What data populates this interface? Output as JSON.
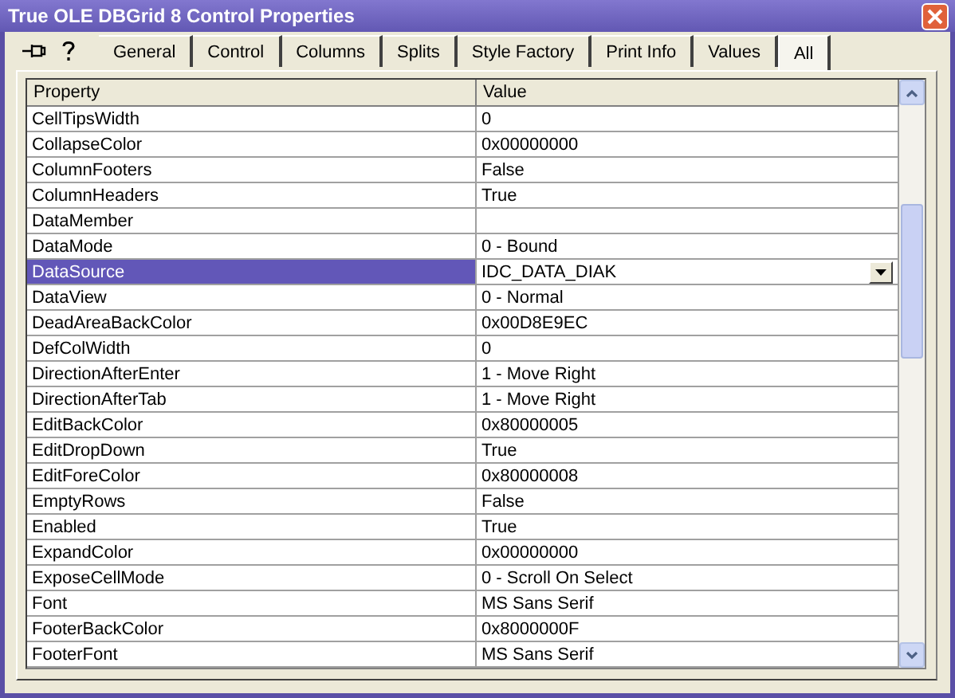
{
  "window": {
    "title": "True OLE DBGrid 8  Control Properties"
  },
  "tabs": [
    {
      "label": "General",
      "selected": false
    },
    {
      "label": "Control",
      "selected": false
    },
    {
      "label": "Columns",
      "selected": false
    },
    {
      "label": "Splits",
      "selected": false
    },
    {
      "label": "Style Factory",
      "selected": false
    },
    {
      "label": "Print Info",
      "selected": false
    },
    {
      "label": "Values",
      "selected": false
    },
    {
      "label": "All",
      "selected": true
    }
  ],
  "table": {
    "columns": [
      "Property",
      "Value"
    ],
    "rows": [
      {
        "property": "CellTipsWidth",
        "value": "0",
        "kind": "text",
        "selected": false
      },
      {
        "property": "CollapseColor",
        "value": "0x00000000",
        "kind": "text",
        "selected": false
      },
      {
        "property": "ColumnFooters",
        "value": "False",
        "kind": "text",
        "selected": false
      },
      {
        "property": "ColumnHeaders",
        "value": "True",
        "kind": "text",
        "selected": false
      },
      {
        "property": "DataMember",
        "value": "",
        "kind": "text",
        "selected": false
      },
      {
        "property": "DataMode",
        "value": "0 - Bound",
        "kind": "text",
        "selected": false
      },
      {
        "property": "DataSource",
        "value": "IDC_DATA_DIAK",
        "kind": "dropdown",
        "selected": true
      },
      {
        "property": "DataView",
        "value": "0 - Normal",
        "kind": "text",
        "selected": false
      },
      {
        "property": "DeadAreaBackColor",
        "value": "0x00D8E9EC",
        "kind": "text",
        "selected": false
      },
      {
        "property": "DefColWidth",
        "value": "0",
        "kind": "text",
        "selected": false
      },
      {
        "property": "DirectionAfterEnter",
        "value": "1 - Move Right",
        "kind": "text",
        "selected": false
      },
      {
        "property": "DirectionAfterTab",
        "value": "1 - Move Right",
        "kind": "text",
        "selected": false
      },
      {
        "property": "EditBackColor",
        "value": "0x80000005",
        "kind": "text",
        "selected": false
      },
      {
        "property": "EditDropDown",
        "value": "True",
        "kind": "text",
        "selected": false
      },
      {
        "property": "EditForeColor",
        "value": "0x80000008",
        "kind": "text",
        "selected": false
      },
      {
        "property": "EmptyRows",
        "value": "False",
        "kind": "text",
        "selected": false
      },
      {
        "property": "Enabled",
        "value": "True",
        "kind": "text",
        "selected": false
      },
      {
        "property": "ExpandColor",
        "value": "0x00000000",
        "kind": "text",
        "selected": false
      },
      {
        "property": "ExposeCellMode",
        "value": "0 - Scroll On Select",
        "kind": "text",
        "selected": false
      },
      {
        "property": "Font",
        "value": "MS Sans Serif",
        "kind": "text",
        "selected": false
      },
      {
        "property": "FooterBackColor",
        "value": "0x8000000F",
        "kind": "text",
        "selected": false
      },
      {
        "property": "FooterFont",
        "value": "MS Sans Serif",
        "kind": "text",
        "selected": false
      }
    ]
  }
}
